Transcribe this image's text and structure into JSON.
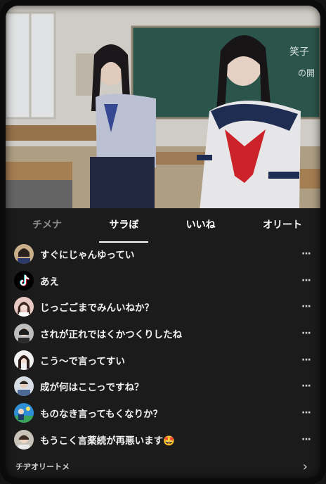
{
  "tabs": [
    {
      "label": "チメナ",
      "state": "inactive"
    },
    {
      "label": "サラぼ",
      "state": "active"
    },
    {
      "label": "いいね",
      "state": "inactive"
    },
    {
      "label": "オリート",
      "state": "inactive"
    }
  ],
  "rows": [
    {
      "text": "すぐにじゃんゆってい",
      "avatar": "person-avatar"
    },
    {
      "text": "あえ",
      "avatar": "tiktok-logo-icon"
    },
    {
      "text": "じっごごまでみんいねか？",
      "avatar": "person-avatar"
    },
    {
      "text": "されが正れではくかつくりしたね",
      "avatar": "person-avatar"
    },
    {
      "text": "こう〜で言ってすい",
      "avatar": "person-avatar"
    },
    {
      "text": "成が何はここっですね？",
      "avatar": "person-avatar"
    },
    {
      "text": "ものなき言ってもくなりか？",
      "avatar": "person-avatar"
    },
    {
      "text": "もうこく言薬続が再悪います🤩",
      "avatar": "person-avatar"
    }
  ],
  "more_glyph": "···",
  "footer": {
    "label": "チヂオリートメ",
    "chevron": "›"
  },
  "colors": {
    "panel": "#1b1b1b",
    "text": "#f2f2f2",
    "dim_tab": "#8a8a8a"
  }
}
